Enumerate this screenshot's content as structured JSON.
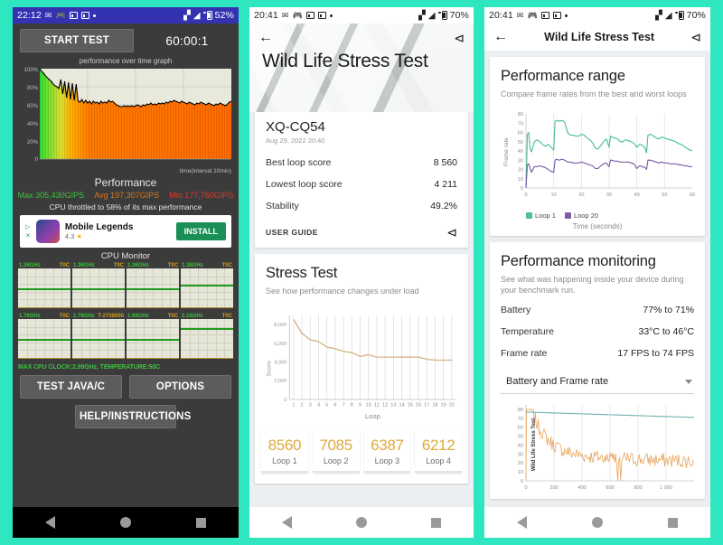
{
  "panel1": {
    "statusbar": {
      "time": "22:12",
      "battery": "52%",
      "icons": [
        "message-icon",
        "gamepad-icon",
        "app-icon",
        "app-icon",
        "dot-icon"
      ],
      "right_icons": [
        "wifi-icon",
        "signal-icon",
        "battery-icon"
      ]
    },
    "start_button": "START TEST",
    "timer": "60:00:1",
    "graph_title": "performance over time graph",
    "y_labels": [
      "100%",
      "80%",
      "60%",
      "40%",
      "20%",
      "0"
    ],
    "x_axis_label": "time(interval 10min)",
    "performance_heading": "Performance",
    "stat_max": "Max 305,430GIPS",
    "stat_avg": "Avg 197,307GIPS",
    "stat_min": "Min 177,760GIPS",
    "throttle_note": "CPU throttled to 58% of its max performance",
    "ad": {
      "title": "Mobile Legends",
      "rating": "4.3",
      "install": "INSTALL",
      "ad_marks": [
        "ad-triangle-icon",
        "ad-close-icon"
      ]
    },
    "cpu_monitor_title": "CPU Monitor",
    "cpu_cells": [
      {
        "ghz": "1.36GHz",
        "toc": "T0C",
        "line": 52
      },
      {
        "ghz": "1.36GHz",
        "toc": "T0C",
        "line": 52
      },
      {
        "ghz": "1.36GHz",
        "toc": "T0C",
        "line": 52
      },
      {
        "ghz": "1.36GHz",
        "toc": "T0C",
        "line": 43
      },
      {
        "ghz": "1.76GHz",
        "toc": "T0C",
        "line": 52
      },
      {
        "ghz": "1.76GHz",
        "toc": "T-2730000",
        "line": 52
      },
      {
        "ghz": "1.66GHz",
        "toc": "T0C",
        "line": 52
      },
      {
        "ghz": "2.16GHz",
        "toc": "T0C",
        "line": 24
      }
    ],
    "cpu_footer": "MAX CPU CLOCK:2.99GHz,  TEMPERATURE:50C",
    "test_java_button": "TEST JAVA/C",
    "options_button": "OPTIONS",
    "help_button": "HELP/INSTRUCTIONS",
    "nav": [
      "back-icon",
      "home-icon",
      "recents-icon"
    ]
  },
  "panel2": {
    "statusbar": {
      "time": "20:41",
      "battery": "70%"
    },
    "back_icon": "back-arrow-icon",
    "share_icon": "share-icon",
    "hero_title": "Wild Life Stress Test",
    "device_name": "XQ-CQ54",
    "device_date": "Aug 29, 2022 20:40",
    "rows": [
      {
        "label": "Best loop score",
        "value": "8 560"
      },
      {
        "label": "Lowest loop score",
        "value": "4 211"
      },
      {
        "label": "Stability",
        "value": "49.2%"
      }
    ],
    "user_guide": "USER GUIDE",
    "stress_title": "Stress Test",
    "stress_sub": "See how performance changes under load",
    "loop_cards": [
      {
        "score": "8560",
        "label": "Loop 1"
      },
      {
        "score": "7085",
        "label": "Loop 2"
      },
      {
        "score": "6387",
        "label": "Loop 3"
      },
      {
        "score": "6212",
        "label": "Loop 4"
      }
    ],
    "nav": [
      "back-icon",
      "home-icon",
      "recents-icon"
    ]
  },
  "panel3": {
    "statusbar": {
      "time": "20:41",
      "battery": "70%"
    },
    "appbar_title": "Wild Life Stress Test",
    "back_icon": "back-arrow-icon",
    "share_icon": "share-icon",
    "range_title": "Performance range",
    "range_sub": "Compare frame rates from the best and worst loops",
    "monitor_title": "Performance monitoring",
    "monitor_sub": "See what was happening inside your device during your benchmark run.",
    "monitor_rows": [
      {
        "label": "Battery",
        "value": "77% to 71%"
      },
      {
        "label": "Temperature",
        "value": "33°C to 46°C"
      },
      {
        "label": "Frame rate",
        "value": "17 FPS to 74 FPS"
      }
    ],
    "select_value": "Battery and Frame rate",
    "nav": [
      "back-icon",
      "home-icon",
      "recents-icon"
    ]
  },
  "colors": {
    "page_background": "#2ee6c0",
    "loop1_green": "#4cbf93",
    "loop20_purple": "#7b5ea7",
    "score_line": "#d6b483",
    "loop_score_text": "#e0a93b",
    "battery_teal": "#6fb3ae",
    "framerate_orange": "#e8a45c",
    "statusbar_blue": "#3333b2"
  },
  "chart_data": [
    {
      "type": "area",
      "id": "performance-over-time",
      "title": "performance over time graph",
      "xlabel": "time(interval 10min)",
      "ylabel": "",
      "ylim": [
        0,
        100
      ],
      "ytick_labels": [
        "0",
        "20%",
        "40%",
        "60%",
        "80%",
        "100%"
      ],
      "x": [
        0,
        1,
        2,
        3,
        4,
        5,
        6,
        7,
        8,
        9,
        10,
        11,
        12,
        13,
        14,
        15,
        16,
        17,
        18,
        19,
        20,
        21,
        22,
        23,
        24,
        25,
        26,
        27,
        28,
        29,
        30,
        31,
        32,
        33,
        34,
        35,
        36,
        37,
        38,
        39,
        40,
        41,
        42,
        43,
        44,
        45,
        46,
        47,
        48,
        49,
        50,
        51,
        52,
        53,
        54,
        55,
        56,
        57,
        58,
        59,
        60,
        61,
        62,
        63,
        64,
        65,
        66,
        67,
        68,
        69,
        70,
        71,
        72,
        73,
        74,
        75,
        76,
        77,
        78,
        79,
        80,
        81,
        82,
        83,
        84,
        85,
        86,
        87,
        88,
        89,
        90,
        91,
        92,
        93,
        94,
        95,
        96,
        97,
        98,
        99,
        100
      ],
      "values": [
        100,
        97,
        95,
        92,
        90,
        88,
        86,
        83,
        81,
        80,
        78,
        88,
        72,
        86,
        68,
        85,
        66,
        84,
        65,
        83,
        64,
        63,
        66,
        62,
        65,
        62,
        64,
        61,
        64,
        62,
        63,
        61,
        64,
        62,
        63,
        62,
        65,
        63,
        64,
        62,
        60,
        59,
        58,
        58,
        59,
        58,
        59,
        58,
        59,
        58,
        59,
        60,
        59,
        58,
        60,
        59,
        61,
        60,
        62,
        60,
        61,
        60,
        62,
        61,
        62,
        61,
        63,
        62,
        64,
        63,
        65,
        64,
        63,
        62,
        64,
        63,
        62,
        61,
        63,
        62,
        61,
        60,
        62,
        61,
        63,
        62,
        61,
        60,
        62,
        61,
        60,
        59,
        61,
        60,
        62,
        61,
        60,
        59,
        61,
        63,
        64
      ],
      "series": [
        {
          "name": "performance",
          "values_note": "black line over green-yellow-orange gradient fill"
        }
      ],
      "grid": true
    },
    {
      "type": "line",
      "id": "stress-test-scores",
      "title": "Stress Test",
      "subtitle": "See how performance changes under load",
      "xlabel": "Loop",
      "ylabel": "Score",
      "ylim": [
        0,
        9000
      ],
      "ytick_labels": [
        "0",
        "2,000",
        "4,000",
        "6,000",
        "8,000"
      ],
      "categories": [
        1,
        2,
        3,
        4,
        5,
        6,
        7,
        8,
        9,
        10,
        11,
        12,
        13,
        14,
        15,
        16,
        17,
        18,
        19,
        20
      ],
      "values": [
        8560,
        7085,
        6387,
        6212,
        5600,
        5430,
        5150,
        5010,
        4600,
        4790,
        4530,
        4520,
        4530,
        4540,
        4540,
        4540,
        4290,
        4210,
        4205,
        4211
      ],
      "line_color": "#d6b483",
      "grid": true,
      "legend": "none"
    },
    {
      "type": "line",
      "id": "performance-range-framerate",
      "title": "Performance range",
      "subtitle": "Compare frame rates from the best and worst loops",
      "xlabel": "Time (seconds)",
      "ylabel": "Frame rate",
      "xlim": [
        0,
        60
      ],
      "ylim": [
        0,
        80
      ],
      "ytick_labels": [
        "0",
        "10",
        "20",
        "30",
        "40",
        "50",
        "60",
        "70",
        "80"
      ],
      "xtick_labels": [
        "0",
        "10",
        "20",
        "30",
        "40",
        "50",
        "60"
      ],
      "legend": [
        "Loop 1",
        "Loop 20"
      ],
      "legend_position": "bottom-left",
      "series": [
        {
          "name": "Loop 1",
          "color": "#4cbf93",
          "x": [
            0,
            0.5,
            1,
            1.5,
            2,
            3,
            4,
            5,
            6,
            7,
            8,
            9,
            10,
            10.5,
            11,
            12,
            13,
            14,
            15,
            16,
            17,
            18,
            19,
            20,
            21,
            22,
            23,
            24,
            25,
            26,
            27,
            28,
            29,
            30,
            30.5,
            31,
            32,
            33,
            34,
            35,
            36,
            37,
            38,
            39,
            40,
            41,
            42,
            43,
            43.5,
            44,
            45,
            46,
            47,
            48,
            49,
            50,
            51,
            52,
            53,
            54,
            55,
            56,
            57,
            58,
            59,
            60
          ],
          "y": [
            0,
            58,
            60,
            42,
            39,
            50,
            52,
            50,
            47,
            45,
            47,
            44,
            41,
            72,
            73,
            72,
            73,
            71,
            60,
            57,
            57,
            56,
            56,
            58,
            57,
            54,
            52,
            49,
            43,
            42,
            46,
            50,
            53,
            44,
            56,
            55,
            54,
            53,
            50,
            50,
            52,
            51,
            50,
            48,
            44,
            47,
            46,
            43,
            38,
            57,
            58,
            56,
            54,
            53,
            55,
            54,
            53,
            52,
            51,
            50,
            48,
            47,
            45,
            43,
            41,
            40,
            40
          ]
        },
        {
          "name": "Loop 20",
          "color": "#7b5ea7",
          "x": [
            0,
            0.5,
            1,
            1.5,
            2,
            3,
            4,
            5,
            6,
            7,
            8,
            9,
            10,
            10.5,
            11,
            12,
            13,
            14,
            15,
            16,
            17,
            18,
            19,
            20,
            21,
            22,
            23,
            24,
            25,
            26,
            27,
            28,
            29,
            30,
            30.5,
            31,
            32,
            33,
            34,
            35,
            36,
            37,
            38,
            39,
            40,
            41,
            42,
            43,
            43.5,
            44,
            45,
            46,
            47,
            48,
            49,
            50,
            51,
            52,
            53,
            54,
            55,
            56,
            57,
            58,
            59,
            60
          ],
          "y": [
            0,
            25,
            26,
            21,
            17,
            23,
            23,
            24,
            23,
            22,
            20,
            18,
            17,
            30,
            31,
            30,
            31,
            30,
            28,
            28,
            27,
            27,
            27,
            28,
            27,
            26,
            25,
            24,
            21,
            21,
            24,
            26,
            27,
            23,
            30,
            30,
            29,
            29,
            28,
            28,
            28,
            28,
            27,
            26,
            21,
            24,
            23,
            22,
            20,
            30,
            30,
            29,
            28,
            27,
            28,
            27,
            27,
            26,
            26,
            26,
            25,
            25,
            24,
            24,
            23,
            23,
            24
          ]
        }
      ],
      "grid": true
    },
    {
      "type": "line",
      "id": "battery-and-frame-rate",
      "title": "Battery and Frame rate",
      "ylabel": "Wild Life Stress Test",
      "xlim": [
        0,
        1200
      ],
      "ylim": [
        0,
        85
      ],
      "ytick_labels": [
        "0",
        "10",
        "20",
        "30",
        "40",
        "50",
        "60",
        "70",
        "80"
      ],
      "xtick_labels": [
        "0",
        "200",
        "400",
        "600",
        "800",
        "1 000"
      ],
      "series": [
        {
          "name": "Battery",
          "color": "#6fb3ae",
          "description": "descends slowly from 77 to 71"
        },
        {
          "name": "Frame rate",
          "color": "#e8a45c",
          "description": "noisy, starts at ~72 and settles around 20-35 with drops to 0"
        }
      ],
      "grid": true
    }
  ]
}
